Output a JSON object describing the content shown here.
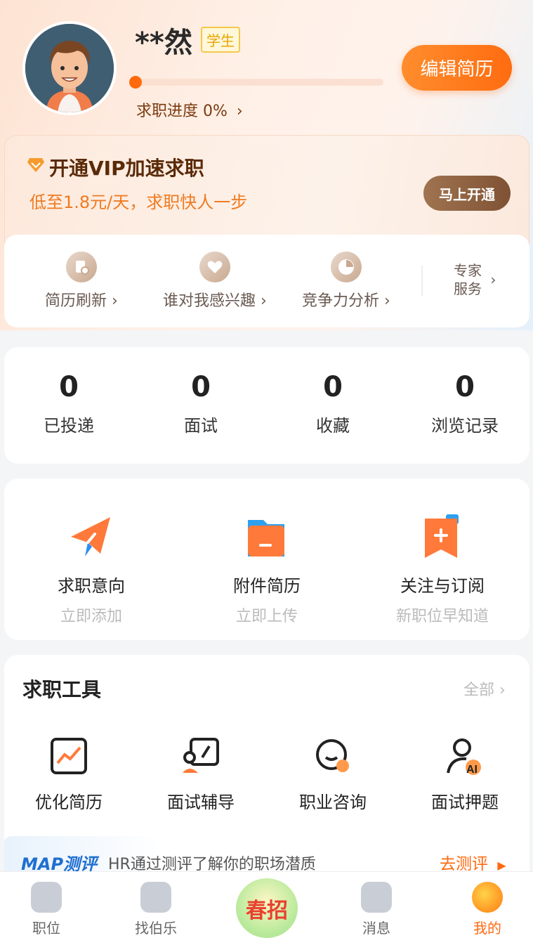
{
  "profile": {
    "name": "**然",
    "badge": "学生",
    "progress_label": "求职进度 0%",
    "progress_value": 0,
    "edit_button": "编辑简历"
  },
  "vip": {
    "title": "开通VIP加速求职",
    "subtitle": "低至1.8元/天，求职快人一步",
    "button": "马上开通",
    "services": [
      {
        "label": "简历刷新",
        "icon": "resume-refresh-icon"
      },
      {
        "label": "谁对我感兴趣",
        "icon": "heart-icon"
      },
      {
        "label": "竞争力分析",
        "icon": "pie-chart-icon"
      }
    ],
    "expert_line1": "专家",
    "expert_line2": "服务"
  },
  "stats": [
    {
      "value": "0",
      "label": "已投递"
    },
    {
      "value": "0",
      "label": "面试"
    },
    {
      "value": "0",
      "label": "收藏"
    },
    {
      "value": "0",
      "label": "浏览记录"
    }
  ],
  "actions": [
    {
      "label": "求职意向",
      "sub": "立即添加",
      "icon": "paper-plane-icon"
    },
    {
      "label": "附件简历",
      "sub": "立即上传",
      "icon": "folder-icon"
    },
    {
      "label": "关注与订阅",
      "sub": "新职位早知道",
      "icon": "bookmark-add-icon"
    }
  ],
  "tools": {
    "title": "求职工具",
    "all_link": "全部",
    "items": [
      {
        "label": "优化简历",
        "icon": "chart-up-icon"
      },
      {
        "label": "面试辅导",
        "icon": "interview-icon"
      },
      {
        "label": "职业咨询",
        "icon": "chat-icon"
      },
      {
        "label": "面试押题",
        "icon": "ai-person-icon"
      }
    ]
  },
  "map": {
    "title": "MAP测评",
    "desc": "HR通过测评了解你的职场潜质",
    "action": "去测评"
  },
  "tabs": [
    {
      "label": "职位",
      "icon": "bag-icon"
    },
    {
      "label": "找伯乐",
      "icon": "leaf-icon"
    },
    {
      "label": "春招",
      "icon": "spring-recruit-icon"
    },
    {
      "label": "消息",
      "icon": "message-icon"
    },
    {
      "label": "我的",
      "icon": "profile-icon"
    }
  ],
  "colors": {
    "accent": "#ff6a10",
    "vip_brown": "#7e5234",
    "map_blue": "#1f6fd1"
  }
}
